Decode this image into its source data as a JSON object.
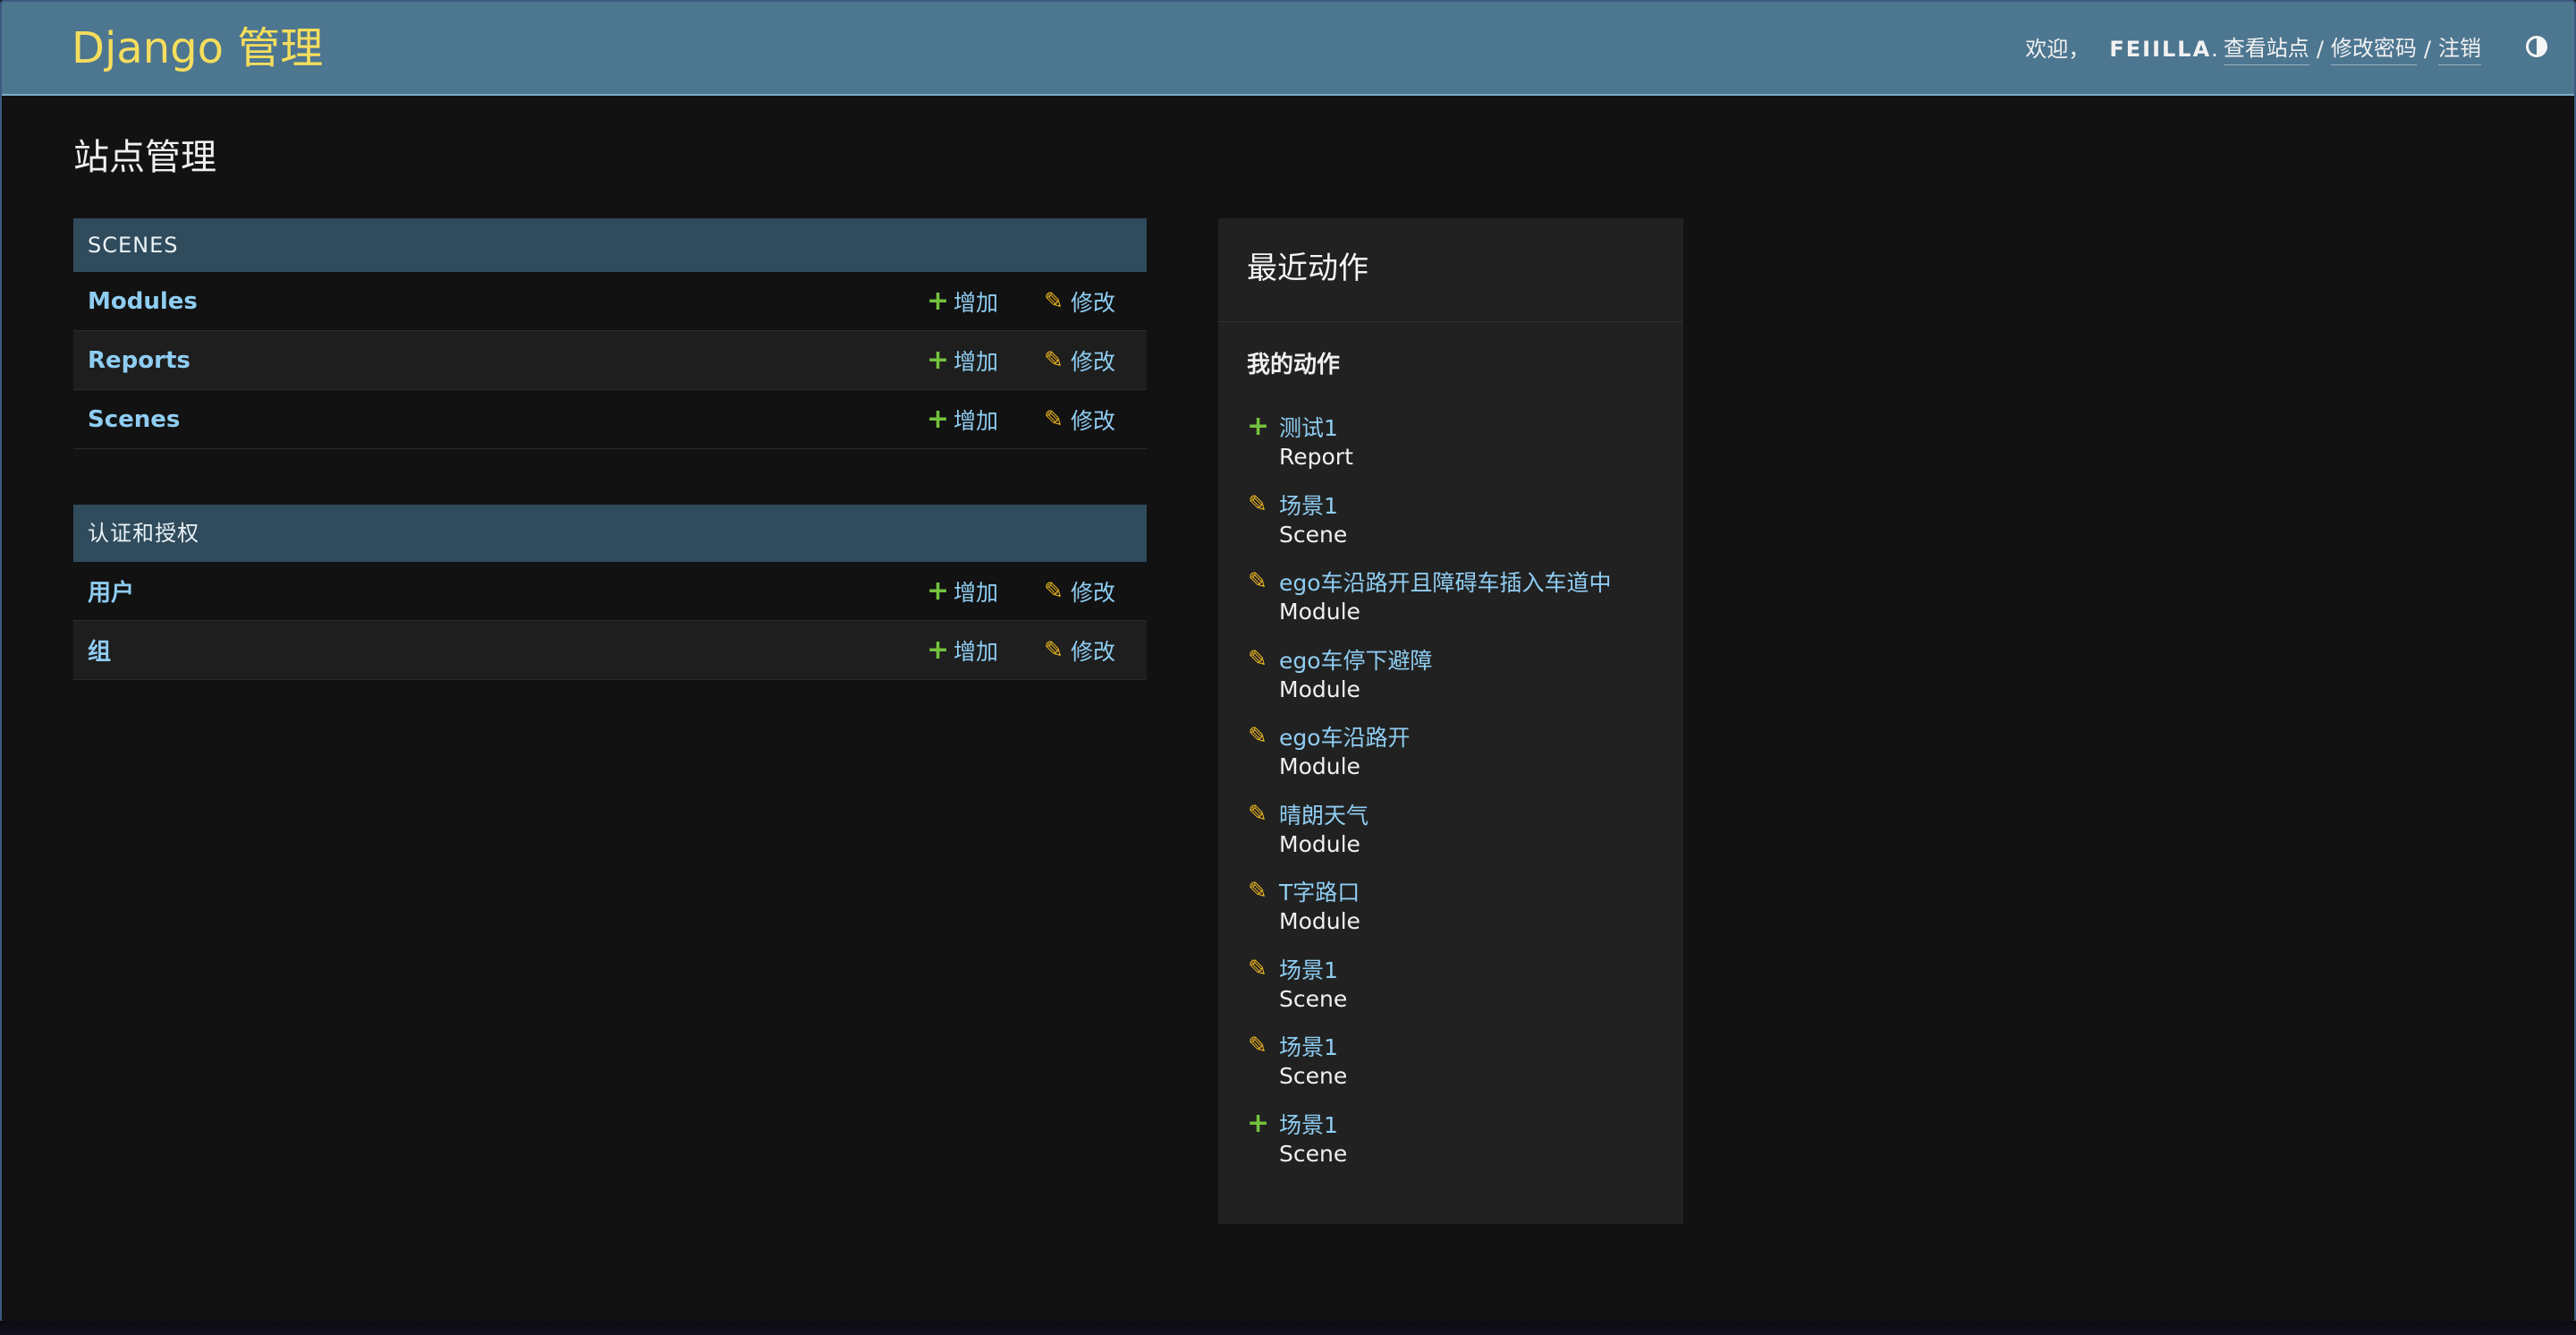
{
  "header": {
    "branding": "Django 管理",
    "welcome": "欢迎，",
    "user_name": "FEIILLA",
    "user_name_suffix": ".",
    "view_site": "查看站点",
    "change_password": "修改密码",
    "logout": "注销",
    "separator": "/"
  },
  "page_title": "站点管理",
  "apps": [
    {
      "caption": "SCENES",
      "models": [
        {
          "name": "Modules",
          "add": "增加",
          "change": "修改"
        },
        {
          "name": "Reports",
          "add": "增加",
          "change": "修改"
        },
        {
          "name": "Scenes",
          "add": "增加",
          "change": "修改"
        }
      ]
    },
    {
      "caption": "认证和授权",
      "models": [
        {
          "name": "用户",
          "add": "增加",
          "change": "修改"
        },
        {
          "name": "组",
          "add": "增加",
          "change": "修改"
        }
      ]
    }
  ],
  "recent_actions": {
    "title": "最近动作",
    "subtitle": "我的动作",
    "items": [
      {
        "action": "add",
        "icon": "plus-icon",
        "name": "测试1",
        "type": "Report"
      },
      {
        "action": "change",
        "icon": "pencil-icon",
        "name": "场景1",
        "type": "Scene"
      },
      {
        "action": "change",
        "icon": "pencil-icon",
        "name": "ego车沿路开且障碍车插入车道中",
        "type": "Module"
      },
      {
        "action": "change",
        "icon": "pencil-icon",
        "name": "ego车停下避障",
        "type": "Module"
      },
      {
        "action": "change",
        "icon": "pencil-icon",
        "name": "ego车沿路开",
        "type": "Module"
      },
      {
        "action": "change",
        "icon": "pencil-icon",
        "name": "晴朗天气",
        "type": "Module"
      },
      {
        "action": "change",
        "icon": "pencil-icon",
        "name": "T字路口",
        "type": "Module"
      },
      {
        "action": "change",
        "icon": "pencil-icon",
        "name": "场景1",
        "type": "Scene"
      },
      {
        "action": "change",
        "icon": "pencil-icon",
        "name": "场景1",
        "type": "Scene"
      },
      {
        "action": "add",
        "icon": "plus-icon",
        "name": "场景1",
        "type": "Scene"
      }
    ]
  },
  "colors": {
    "header_bg": "#4d7690",
    "branding": "#f5dd5d",
    "link": "#8fcdf2",
    "module_caption_bg": "#2f4b5c",
    "add_icon": "#74c23d",
    "change_icon": "#eab320",
    "page_bg": "#121212",
    "panel_bg": "#212121"
  }
}
